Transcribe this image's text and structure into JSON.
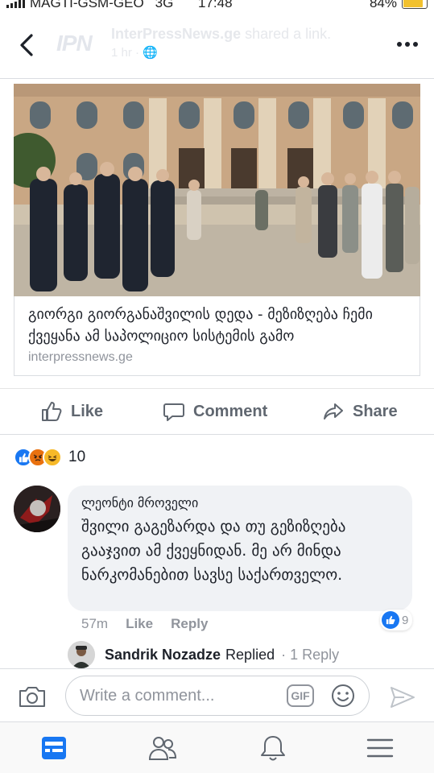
{
  "status_bar": {
    "carrier": "MAGTI-GSM-GEO",
    "network": "3G",
    "time": "17:48",
    "battery": "84%"
  },
  "header": {
    "logo_text": "IPN",
    "page_name": "InterPressNews.ge",
    "action": "shared a link.",
    "time_ago": "1 hr"
  },
  "link_card": {
    "title": "გიორგი გიორგანაშვილის დედა - მეზიზღება ჩემი ქვეყანა ამ საპოლიციო სისტემის გამო",
    "domain": "interpressnews.ge"
  },
  "actions": {
    "like_label": "Like",
    "comment_label": "Comment",
    "share_label": "Share"
  },
  "reactions": {
    "count": "10",
    "types": [
      "like",
      "angry",
      "haha"
    ]
  },
  "comment": {
    "author": "ლეონტი მროველი",
    "text": "შვილი გაგეზარდა და თუ გეზიზღება გააჯვით ამ ქვეყნიდან. მე არ მინდა ნარკომანებით სავსე საქართველო.",
    "time_ago": "57m",
    "like_label": "Like",
    "reply_label": "Reply",
    "like_count": "9"
  },
  "reply": {
    "author": "Sandrik Nozadze",
    "action": "Replied",
    "count": "· 1 Reply"
  },
  "composer": {
    "placeholder": "Write a comment...",
    "gif_label": "GIF"
  },
  "colors": {
    "accent": "#1877f2",
    "text": "#1d2129",
    "muted": "#90949c",
    "bubble": "#f0f2f5"
  }
}
